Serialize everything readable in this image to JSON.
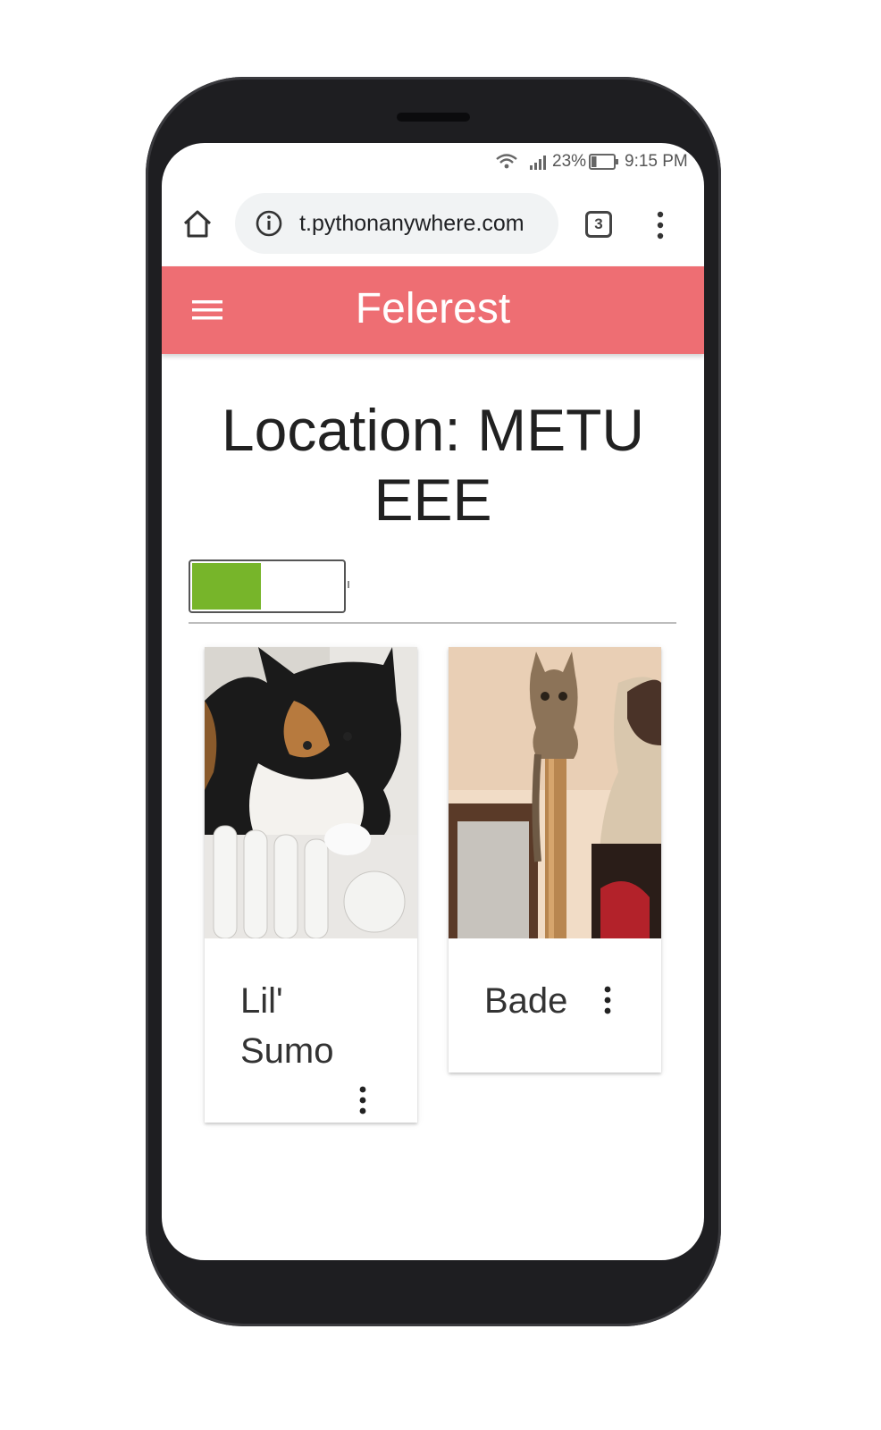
{
  "status_bar": {
    "battery_percent": "23%",
    "time": "9:15 PM",
    "battery_level": 0.23
  },
  "browser": {
    "url": " t.pythonanywhere.com",
    "tab_count": "3"
  },
  "app_bar": {
    "title": "Felerest",
    "color": "#ee6e73"
  },
  "page": {
    "title": "Location: METU EEE",
    "toggle_fill_fraction": 0.46,
    "toggle_color": "#77b52a"
  },
  "cards": [
    {
      "name": "Lil' Sumo",
      "icon": "more-vert-icon"
    },
    {
      "name": "Bade",
      "icon": "more-vert-icon"
    }
  ]
}
